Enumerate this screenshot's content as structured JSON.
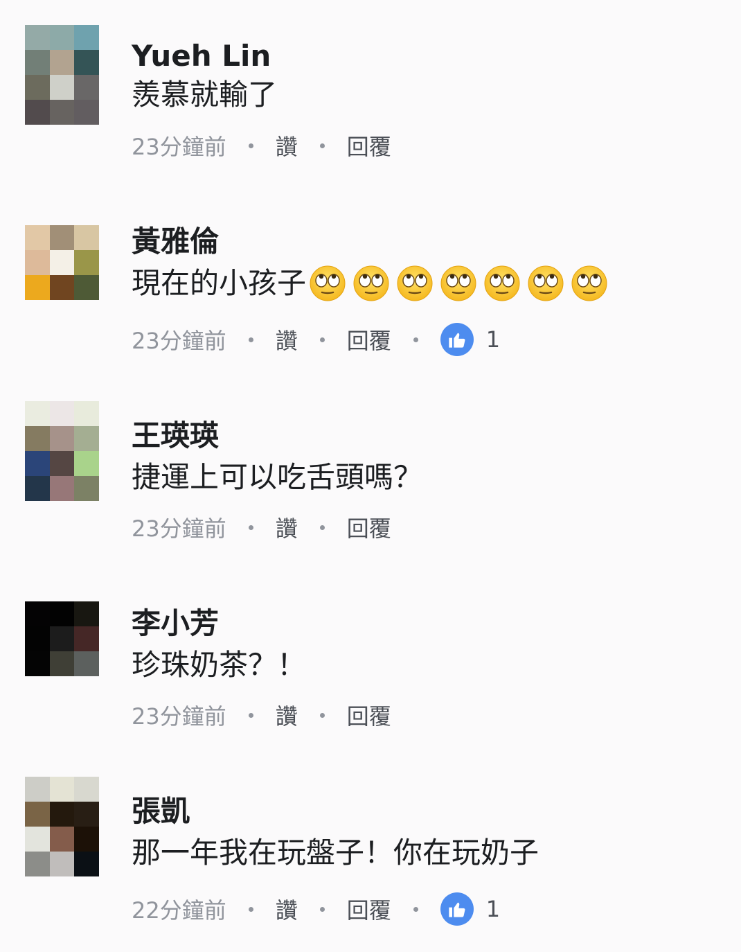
{
  "colors": {
    "background": "#fbfafb",
    "name": "#1c1e21",
    "time": "#90949c",
    "action": "#4b4f56",
    "like_badge": "#4d8cef"
  },
  "comments": [
    {
      "name": "Yueh Lin",
      "text": "羨慕就輸了",
      "time": "23分鐘前",
      "like_label": "讚",
      "reply_label": "回覆",
      "reactions": null,
      "avatar_cells": [
        "#94aaa7",
        "#8daaa8",
        "#6fa2ae",
        "#727f77",
        "#b2a390",
        "#345456",
        "#6c6b5d",
        "#cfd0c9",
        "#696767",
        "#524b4d",
        "#676360",
        "#625d60"
      ]
    },
    {
      "name": "黃雅倫",
      "text": "現在的小孩子",
      "emoji": "eye-roll-face",
      "emoji_count": 7,
      "time": "23分鐘前",
      "like_label": "讚",
      "reply_label": "回覆",
      "reactions": "1",
      "avatar_cells": [
        "#e2c8a6",
        "#a18f77",
        "#d8c6a3",
        "#ddba9a",
        "#f4f0e7",
        "#9a9649",
        "#eca91e",
        "#704520",
        "#4e5a36"
      ]
    },
    {
      "name": "王瑛瑛",
      "text": "捷運上可以吃舌頭嗎？",
      "time": "23分鐘前",
      "like_label": "讚",
      "reply_label": "回覆",
      "reactions": null,
      "avatar_cells": [
        "#eaece0",
        "#ece6e6",
        "#e8ebdc",
        "#857b61",
        "#a6928a",
        "#a4ae92",
        "#2b4579",
        "#554643",
        "#a9d38b",
        "#23364a",
        "#977778",
        "#7c8165"
      ]
    },
    {
      "name": "李小芳",
      "text": "珍珠奶茶？！",
      "time": "23分鐘前",
      "like_label": "讚",
      "reply_label": "回覆",
      "reactions": null,
      "avatar_cells": [
        "#040304",
        "#020202",
        "#181711",
        "#030303",
        "#1c1c1c",
        "#452726",
        "#040404",
        "#3f3f36",
        "#5c605e"
      ]
    },
    {
      "name": "張凱",
      "text": "那一年我在玩盤子！你在玩奶子",
      "time": "22分鐘前",
      "like_label": "讚",
      "reply_label": "回覆",
      "reactions": "1",
      "avatar_cells": [
        "#cdcdc7",
        "#e4e3d4",
        "#d8d8cf",
        "#7a6446",
        "#24190d",
        "#281e14",
        "#e3e4dd",
        "#845c4b",
        "#1c1107",
        "#8c8d89",
        "#c0bdbb",
        "#0b1015"
      ]
    }
  ]
}
